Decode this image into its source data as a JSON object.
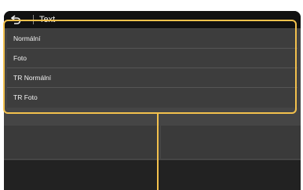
{
  "header": {
    "back_icon": "back-arrow-icon",
    "title": "Text"
  },
  "options": [
    {
      "label": "Normální"
    },
    {
      "label": "Foto"
    },
    {
      "label": "TR Normální"
    },
    {
      "label": "TR Foto"
    }
  ],
  "colors": {
    "accent": "#f3c14d",
    "screen_bg": "#454545",
    "header_bg": "#111111"
  }
}
